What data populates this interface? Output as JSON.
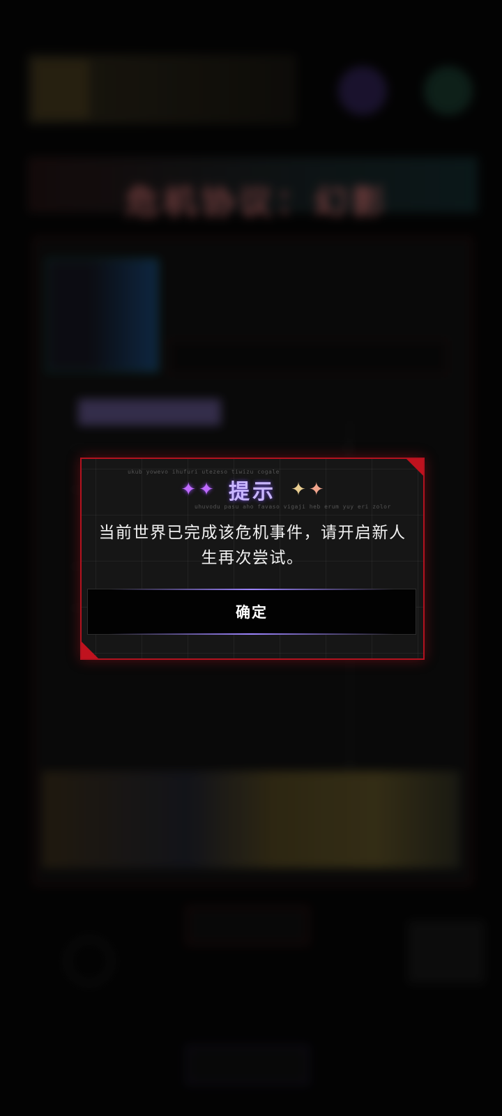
{
  "dialog": {
    "title": "提示",
    "message": "当前世界已完成该危机事件，请开启新人生再次尝试。",
    "confirm_label": "确定",
    "deco_line_1": "ukub yowevo ihufuri utezeso tiwizu cogale",
    "deco_line_2": "uhuvodu pasu aho favaso vigaji heb erum yuy eri zolor",
    "sparkle_left_icons": [
      "sparkle-purple-icon",
      "sparkle-purple-icon"
    ],
    "sparkle_right_icons": [
      "sparkle-gold-icon",
      "sparkle-peach-icon"
    ],
    "accent_color": "#b3121f",
    "title_color": "#c9b6ff"
  },
  "background": {
    "event_title": "危机协议：幻影"
  }
}
